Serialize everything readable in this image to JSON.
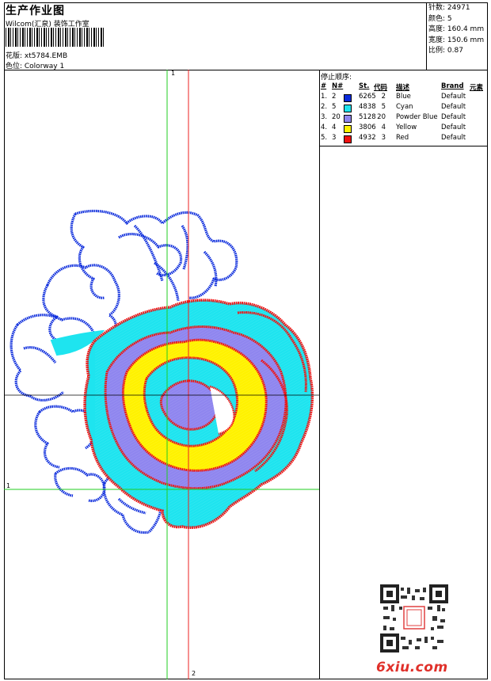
{
  "header": {
    "title": "生产作业图",
    "company": "Wilcom(汇泉) 装饰工作室",
    "design_file": "花版: xt5784.EMB",
    "colorway": "色位: Colorway 1"
  },
  "stats": [
    {
      "label": "针数:",
      "value": "24971"
    },
    {
      "label": "颜色:",
      "value": "5"
    },
    {
      "label": "高度:",
      "value": "160.4 mm"
    },
    {
      "label": "宽度:",
      "value": "150.6 mm"
    },
    {
      "label": "比例:",
      "value": "0.87"
    }
  ],
  "stop_sequence": {
    "title": "停止顺序:",
    "headers": {
      "num": "#",
      "n": "N#",
      "st": "St.",
      "code": "代码",
      "desc": "描述",
      "brand": "Brand",
      "elements": "元素"
    },
    "rows": [
      {
        "idx": "1.",
        "n": "2",
        "color": "#0b2bdc",
        "st": "6265",
        "code": "2",
        "desc": "Blue",
        "brand": "Default"
      },
      {
        "idx": "2.",
        "n": "5",
        "color": "#1ee4ef",
        "st": "4838",
        "code": "5",
        "desc": "Cyan",
        "brand": "Default"
      },
      {
        "idx": "3.",
        "n": "20",
        "color": "#8f86ef",
        "st": "5128",
        "code": "20",
        "desc": "Powder Blue",
        "brand": "Default"
      },
      {
        "idx": "4.",
        "n": "4",
        "color": "#fff200",
        "st": "3806",
        "code": "4",
        "desc": "Yellow",
        "brand": "Default"
      },
      {
        "idx": "5.",
        "n": "3",
        "color": "#ef1010",
        "st": "4932",
        "code": "3",
        "desc": "Red",
        "brand": "Default"
      }
    ]
  },
  "guides": {
    "v1": "1",
    "h1": "1",
    "v2": "2"
  },
  "colors": {
    "guide_green": "#22cc22",
    "guide_red": "#ee2222"
  },
  "watermark": {
    "site": "6xiu.com"
  }
}
